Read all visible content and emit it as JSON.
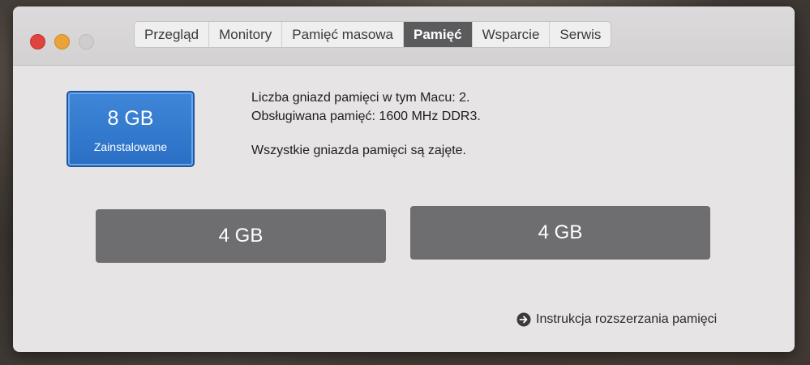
{
  "window": {
    "tabs": [
      {
        "label": "Przegląd",
        "active": false
      },
      {
        "label": "Monitory",
        "active": false
      },
      {
        "label": "Pamięć masowa",
        "active": false
      },
      {
        "label": "Pamięć",
        "active": true
      },
      {
        "label": "Wsparcie",
        "active": false
      },
      {
        "label": "Serwis",
        "active": false
      }
    ]
  },
  "memory": {
    "installed_size": "8 GB",
    "installed_label": "Zainstalowane",
    "slots_info": "Liczba gniazd pamięci w tym Macu: 2.",
    "supported_info": "Obsługiwana pamięć: 1600 MHz DDR3.",
    "status_info": "Wszystkie gniazda pamięci są zajęte.",
    "slots": [
      {
        "size": "4  GB"
      },
      {
        "size": "4  GB"
      }
    ]
  },
  "footer": {
    "upgrade_link_label": "Instrukcja rozszerzania pamięci",
    "upgrade_link_icon": "arrow-circle-right-icon"
  },
  "colors": {
    "active_tab": "#5b5a5c",
    "badge": "#2f76c9",
    "slot": "#6e6d70",
    "close": "#e0443e",
    "minimize": "#e9a33a"
  }
}
